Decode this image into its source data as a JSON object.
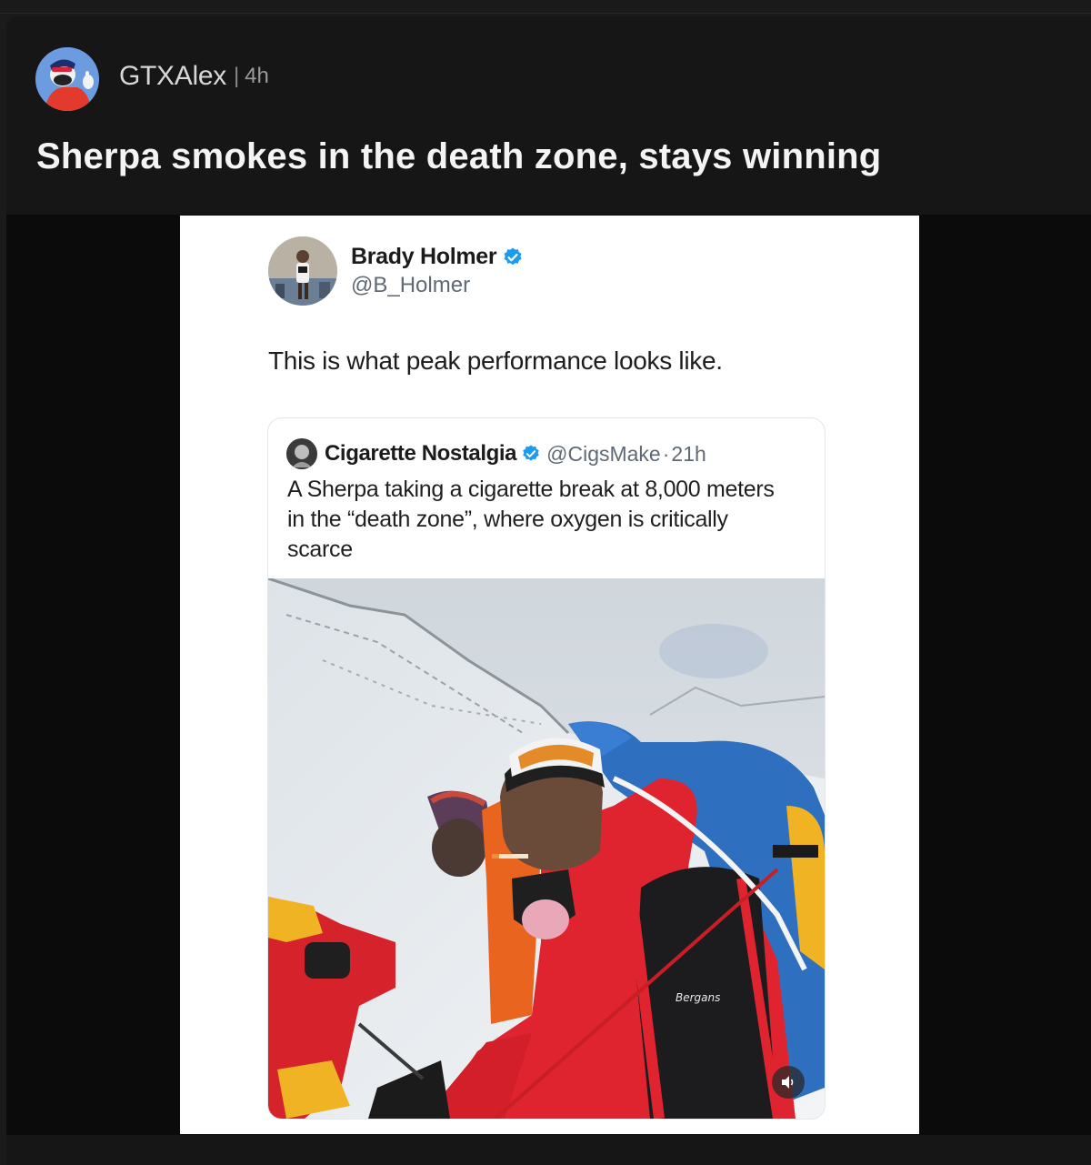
{
  "post": {
    "author": "GTXAlex",
    "separator": "|",
    "time": "4h",
    "title": "Sherpa smokes in the death zone, stays winning",
    "avatar_icon": "goofy-avatar-icon"
  },
  "tweet": {
    "name": "Brady Holmer",
    "handle": "@B_Holmer",
    "text": "This is what peak performance looks like.",
    "verified_color": "#1d9bf0",
    "quote": {
      "name": "Cigarette Nostalgia",
      "handle": "@CigsMake",
      "dot": "·",
      "time": "21h",
      "text": "A Sherpa taking a cigarette break at 8,000 meters in the “death zone”, where oxygen is critically scarce",
      "photo_badge": "Bergans"
    }
  },
  "colors": {
    "background": "#1b1b1b",
    "card": "#161616",
    "title": "#f4f4f4",
    "accent_red": "#e0242f"
  }
}
